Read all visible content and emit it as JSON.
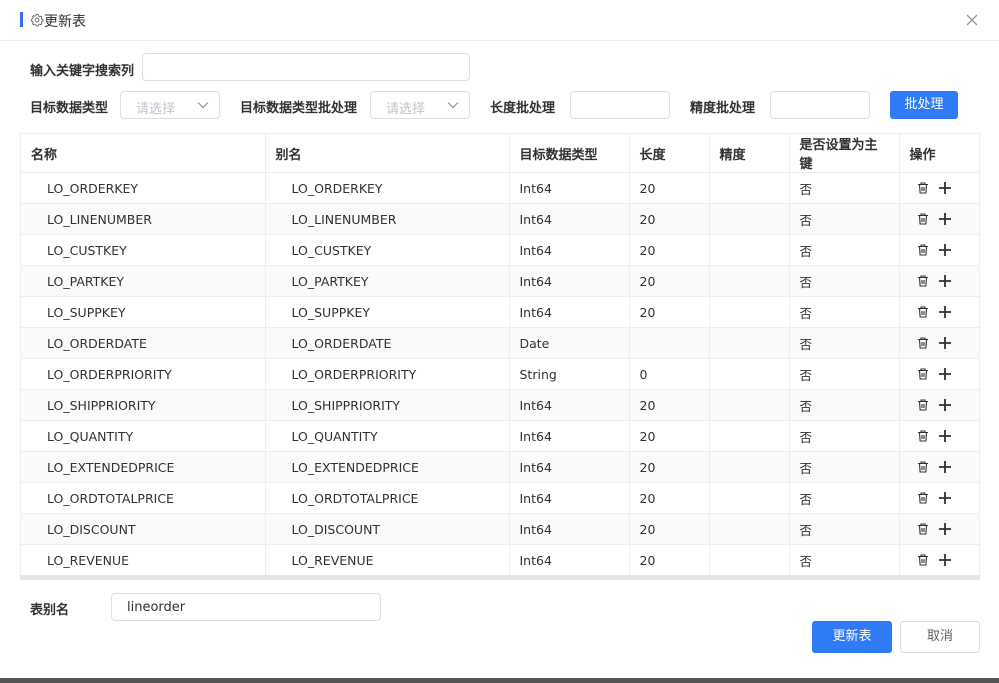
{
  "dialog": {
    "title": "更新表",
    "accent_color": "#2f6df5"
  },
  "filters": {
    "search_label": "输入关键字搜索列",
    "search_value": "",
    "target_type_label": "目标数据类型",
    "target_type_placeholder": "请选择",
    "batch_type_label": "目标数据类型批处理",
    "batch_type_placeholder": "请选择",
    "length_batch_label": "长度批处理",
    "length_batch_value": "",
    "precision_batch_label": "精度批处理",
    "precision_batch_value": "",
    "batch_button": "批处理"
  },
  "table": {
    "headers": [
      "名称",
      "别名",
      "目标数据类型",
      "长度",
      "精度",
      "是否设置为主键",
      "操作"
    ],
    "rows": [
      {
        "name": "LO_ORDERKEY",
        "alias": "LO_ORDERKEY",
        "type": "Int64",
        "length": "20",
        "precision": "",
        "pk": "否"
      },
      {
        "name": "LO_LINENUMBER",
        "alias": "LO_LINENUMBER",
        "type": "Int64",
        "length": "20",
        "precision": "",
        "pk": "否"
      },
      {
        "name": "LO_CUSTKEY",
        "alias": "LO_CUSTKEY",
        "type": "Int64",
        "length": "20",
        "precision": "",
        "pk": "否"
      },
      {
        "name": "LO_PARTKEY",
        "alias": "LO_PARTKEY",
        "type": "Int64",
        "length": "20",
        "precision": "",
        "pk": "否"
      },
      {
        "name": "LO_SUPPKEY",
        "alias": "LO_SUPPKEY",
        "type": "Int64",
        "length": "20",
        "precision": "",
        "pk": "否"
      },
      {
        "name": "LO_ORDERDATE",
        "alias": "LO_ORDERDATE",
        "type": "Date",
        "length": "",
        "precision": "",
        "pk": "否"
      },
      {
        "name": "LO_ORDERPRIORITY",
        "alias": "LO_ORDERPRIORITY",
        "type": "String",
        "length": "0",
        "precision": "",
        "pk": "否"
      },
      {
        "name": "LO_SHIPPRIORITY",
        "alias": "LO_SHIPPRIORITY",
        "type": "Int64",
        "length": "20",
        "precision": "",
        "pk": "否"
      },
      {
        "name": "LO_QUANTITY",
        "alias": "LO_QUANTITY",
        "type": "Int64",
        "length": "20",
        "precision": "",
        "pk": "否"
      },
      {
        "name": "LO_EXTENDEDPRICE",
        "alias": "LO_EXTENDEDPRICE",
        "type": "Int64",
        "length": "20",
        "precision": "",
        "pk": "否"
      },
      {
        "name": "LO_ORDTOTALPRICE",
        "alias": "LO_ORDTOTALPRICE",
        "type": "Int64",
        "length": "20",
        "precision": "",
        "pk": "否"
      },
      {
        "name": "LO_DISCOUNT",
        "alias": "LO_DISCOUNT",
        "type": "Int64",
        "length": "20",
        "precision": "",
        "pk": "否"
      },
      {
        "name": "LO_REVENUE",
        "alias": "LO_REVENUE",
        "type": "Int64",
        "length": "20",
        "precision": "",
        "pk": "否"
      }
    ],
    "row_actions": [
      "trash-icon",
      "plus-icon"
    ]
  },
  "footer": {
    "table_alias_label": "表别名",
    "table_alias_value": "lineorder",
    "update_button": "更新表",
    "cancel_button": "取消"
  }
}
